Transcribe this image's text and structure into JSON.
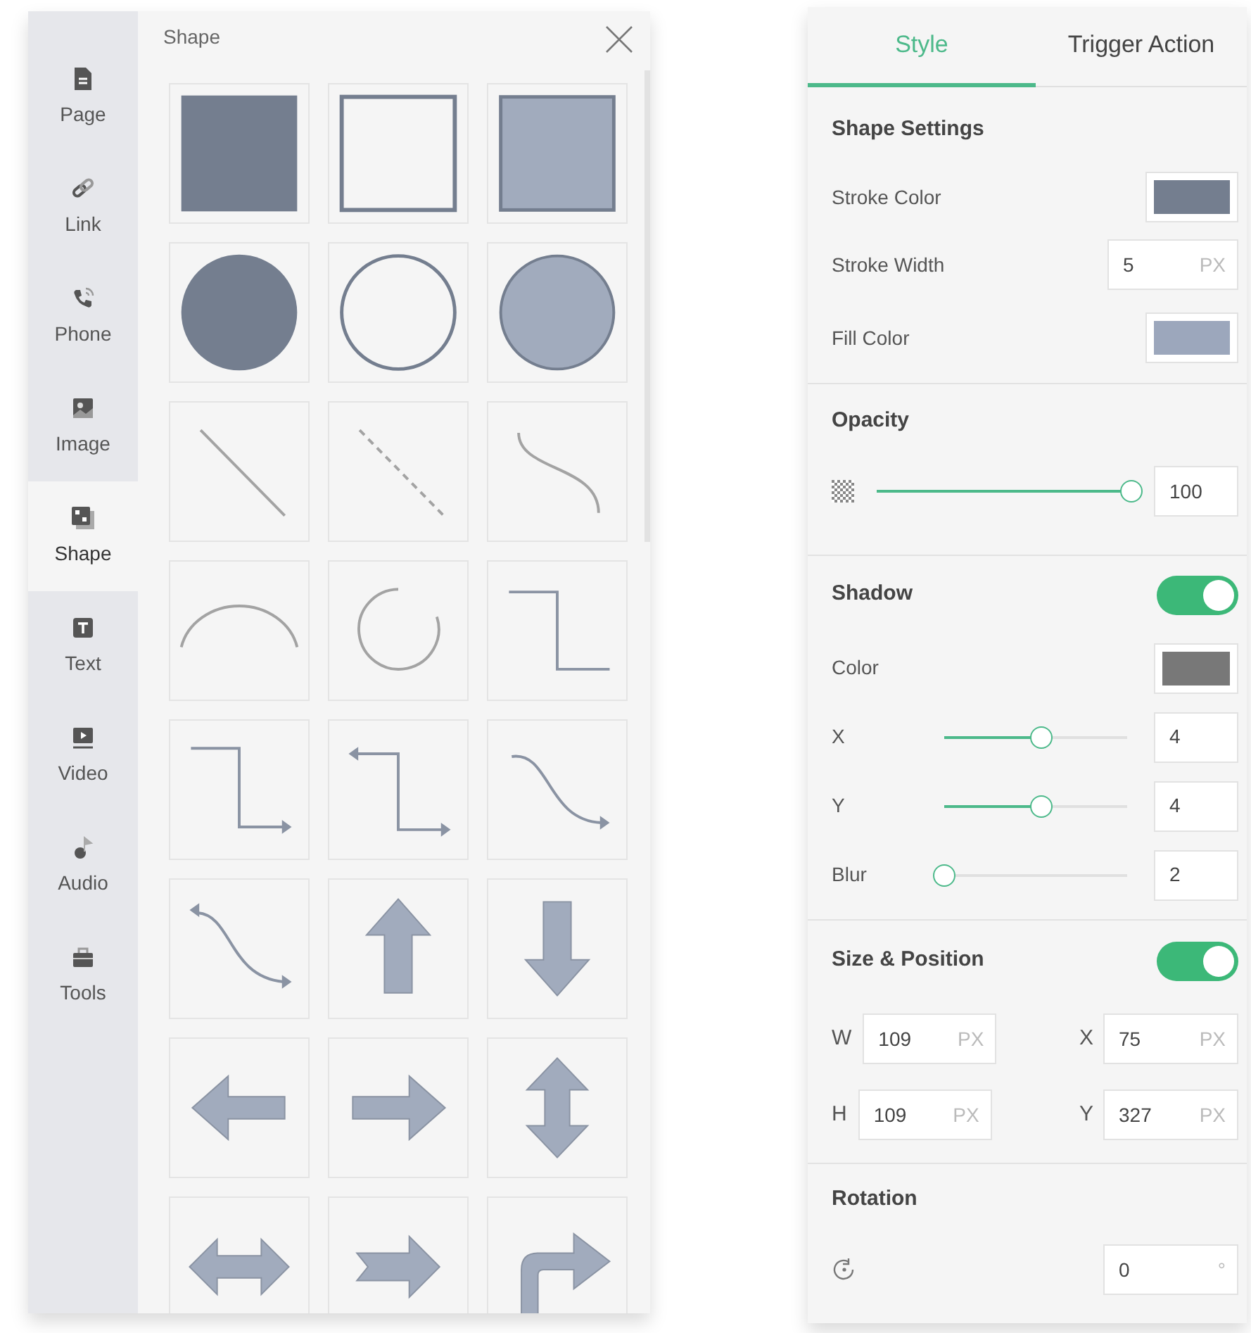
{
  "sidebar": {
    "items": [
      {
        "label": "Page",
        "kind": "page",
        "selected": false
      },
      {
        "label": "Link",
        "kind": "link",
        "selected": false
      },
      {
        "label": "Phone",
        "kind": "phone",
        "selected": false
      },
      {
        "label": "Image",
        "kind": "image",
        "selected": false
      },
      {
        "label": "Shape",
        "kind": "shape",
        "selected": true
      },
      {
        "label": "Text",
        "kind": "text",
        "selected": false
      },
      {
        "label": "Video",
        "kind": "video",
        "selected": false
      },
      {
        "label": "Audio",
        "kind": "audio",
        "selected": false
      },
      {
        "label": "Tools",
        "kind": "tools",
        "selected": false
      }
    ]
  },
  "shape_panel": {
    "title": "Shape",
    "shapes": [
      {
        "kind": "rect-filled"
      },
      {
        "kind": "rect-outline"
      },
      {
        "kind": "rect-light"
      },
      {
        "kind": "circle-filled"
      },
      {
        "kind": "circle-outline"
      },
      {
        "kind": "circle-light"
      },
      {
        "kind": "line"
      },
      {
        "kind": "dashed-line"
      },
      {
        "kind": "curve"
      },
      {
        "kind": "arc"
      },
      {
        "kind": "open-circle"
      },
      {
        "kind": "step-line"
      },
      {
        "kind": "elbow-arrow"
      },
      {
        "kind": "double-elbow-arrow"
      },
      {
        "kind": "curved-arrow"
      },
      {
        "kind": "double-curved-arrow"
      },
      {
        "kind": "arrow-up"
      },
      {
        "kind": "arrow-down"
      },
      {
        "kind": "arrow-left"
      },
      {
        "kind": "arrow-right"
      },
      {
        "kind": "arrow-up-down"
      },
      {
        "kind": "arrow-left-right"
      },
      {
        "kind": "notched-arrow"
      },
      {
        "kind": "bent-arrow"
      }
    ]
  },
  "properties": {
    "tabs": [
      {
        "label": "Style",
        "selected": true
      },
      {
        "label": "Trigger Action",
        "selected": false
      }
    ],
    "shape_settings": {
      "title": "Shape Settings",
      "stroke_color": {
        "label": "Stroke Color",
        "color": "#747e8f"
      },
      "stroke_width": {
        "label": "Stroke Width",
        "value": "5",
        "unit": "PX"
      },
      "fill_color": {
        "label": "Fill Color",
        "color": "#9ca7bc"
      }
    },
    "opacity": {
      "title": "Opacity",
      "level": 1,
      "value": "100"
    },
    "shadow": {
      "title": "Shadow",
      "on": true,
      "color": {
        "label": "Color",
        "color": "#787878"
      },
      "sliders": [
        {
          "label": "X",
          "level": 0.53,
          "value": "4"
        },
        {
          "label": "Y",
          "level": 0.53,
          "value": "4"
        },
        {
          "label": "Blur",
          "level": 0,
          "value": "2"
        }
      ]
    },
    "size_position": {
      "title": "Size & Position",
      "on": true,
      "fields": [
        {
          "label": "W",
          "value": "109",
          "unit": "PX"
        },
        {
          "label": "X",
          "value": "75",
          "unit": "PX"
        },
        {
          "label": "H",
          "value": "109",
          "unit": "PX"
        },
        {
          "label": "Y",
          "value": "327",
          "unit": "PX"
        }
      ]
    },
    "rotation": {
      "title": "Rotation",
      "value": "0",
      "unit": "°"
    }
  }
}
